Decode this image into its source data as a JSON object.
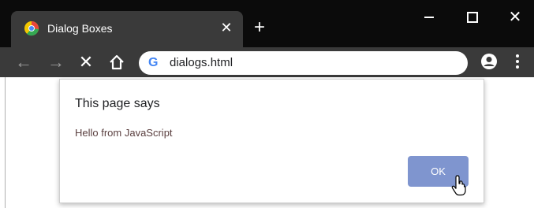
{
  "browser": {
    "tab": {
      "title": "Dialog Boxes",
      "close_glyph": "✕"
    },
    "new_tab_glyph": "+",
    "window_controls": {
      "close_glyph": "✕"
    },
    "toolbar": {
      "back_glyph": "←",
      "forward_glyph": "→",
      "stop_glyph": "✕",
      "omnibox": {
        "search_engine_glyph": "G",
        "url": "dialogs.html"
      }
    }
  },
  "dialog": {
    "title": "This page says",
    "message": "Hello from JavaScript",
    "ok_label": "OK"
  },
  "colors": {
    "tabstrip": "#0b0b0b",
    "active_tab": "#3a3a3a",
    "toolbar": "#3a3a3a",
    "ok_button": "#7f95cf"
  }
}
